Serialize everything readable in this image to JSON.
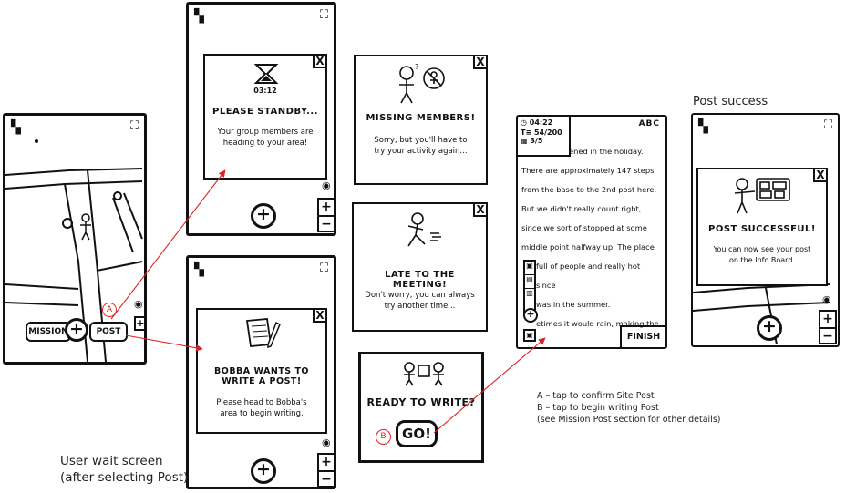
{
  "map_screen": {
    "mission_label": "MISSION",
    "post_label": "POST",
    "marker_a": "A"
  },
  "standby": {
    "timer": "03:12",
    "title": "PLEASE STANDBY...",
    "body": "Your group members are heading to your area!",
    "close": "X"
  },
  "write_prompt": {
    "title": "BOBBA WANTS TO WRITE A POST!",
    "body": "Please head to Bobba's area to begin writing.",
    "close": "X"
  },
  "missing": {
    "title": "MISSING MEMBERS!",
    "body": "Sorry, but you'll have to try your activity again...",
    "close": "X"
  },
  "late": {
    "title": "LATE TO THE MEETING!",
    "body": "Don't worry, you can always try another time...",
    "close": "X"
  },
  "ready": {
    "title": "READY TO WRITE?",
    "go_label": "GO!",
    "marker_b": "B"
  },
  "writing": {
    "time": "04:22",
    "chars": "54/200",
    "pages": "3/5",
    "abc": "ABC",
    "text_lines": [
      "ened in the holiday.",
      "There are approximately 147 steps",
      "from the base to the 2nd post here.",
      "But we didn't really count right,",
      "since we sort of stopped at some",
      "middle point halfway up. The place",
      "full of people and really hot since",
      "was in the summer.",
      "etimes it would rain, making the"
    ],
    "finish_label": "FINISH"
  },
  "success": {
    "caption": "Post success",
    "title": "POST SUCCESSFUL!",
    "body": "You can now see your post on the Info Board.",
    "close": "X"
  },
  "captions": {
    "wait_line1": "User wait screen",
    "wait_line2": "(after selecting Post)"
  },
  "notes": {
    "a": "A – tap to confirm Site Post",
    "b": "B – tap to begin writing Post",
    "c": "(see Mission Post section for other details)"
  },
  "colors": {
    "annotation": "#e02020",
    "ink": "#111111"
  }
}
